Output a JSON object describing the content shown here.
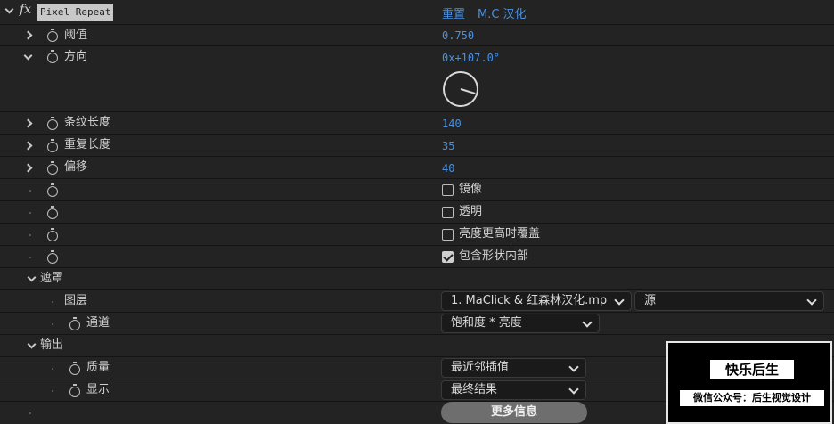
{
  "effect": {
    "fx": "fx",
    "name": "Pixel Repeat",
    "reset": "重置",
    "credit": "M.C 汉化"
  },
  "params": {
    "threshold": {
      "label": "阈值",
      "value": "0.750"
    },
    "direction": {
      "label": "方向",
      "value": "0x+107.0°",
      "angle_degrees": 107
    },
    "stripe_length": {
      "label": "条纹长度",
      "value": "140"
    },
    "repeat_length": {
      "label": "重复长度",
      "value": "35"
    },
    "offset": {
      "label": "偏移",
      "value": "40"
    }
  },
  "checkboxes": [
    {
      "label": "镜像",
      "checked": false
    },
    {
      "label": "透明",
      "checked": false
    },
    {
      "label": "亮度更高时覆盖",
      "checked": false
    },
    {
      "label": "包含形状内部",
      "checked": true
    }
  ],
  "mask": {
    "label": "遮罩",
    "layer_label": "图层",
    "layer_value": "1. MaClick & 红森林汉化.mp",
    "source_value": "源",
    "channel_label": "通道",
    "channel_value": "饱和度 * 亮度"
  },
  "output": {
    "label": "输出",
    "quality_label": "质量",
    "quality_value": "最近邻插值",
    "display_label": "显示",
    "display_value": "最终结果",
    "more_info": "更多信息"
  },
  "watermark": {
    "title": "快乐后生",
    "subtitle": "微信公众号：后生视觉设计"
  },
  "colors": {
    "background": "#232323",
    "value_blue": "#4a90e0",
    "header_bg": "#c8c8c8"
  }
}
